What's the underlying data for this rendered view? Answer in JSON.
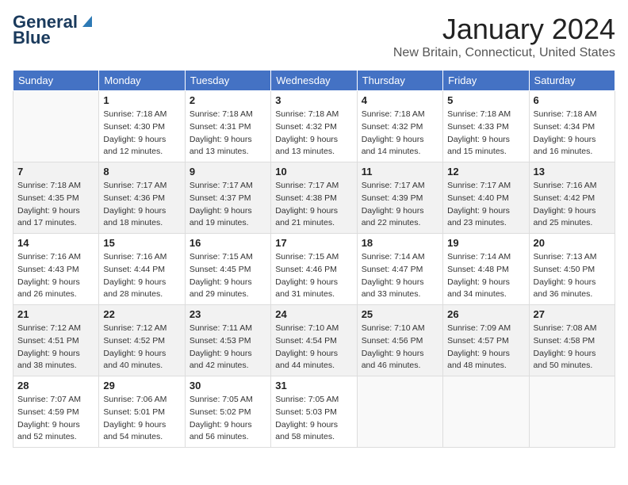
{
  "header": {
    "logo_line1": "General",
    "logo_line2": "Blue",
    "title": "January 2024",
    "subtitle": "New Britain, Connecticut, United States"
  },
  "days_of_week": [
    "Sunday",
    "Monday",
    "Tuesday",
    "Wednesday",
    "Thursday",
    "Friday",
    "Saturday"
  ],
  "weeks": [
    [
      {
        "num": "",
        "sunrise": "",
        "sunset": "",
        "daylight": ""
      },
      {
        "num": "1",
        "sunrise": "Sunrise: 7:18 AM",
        "sunset": "Sunset: 4:30 PM",
        "daylight": "Daylight: 9 hours and 12 minutes."
      },
      {
        "num": "2",
        "sunrise": "Sunrise: 7:18 AM",
        "sunset": "Sunset: 4:31 PM",
        "daylight": "Daylight: 9 hours and 13 minutes."
      },
      {
        "num": "3",
        "sunrise": "Sunrise: 7:18 AM",
        "sunset": "Sunset: 4:32 PM",
        "daylight": "Daylight: 9 hours and 13 minutes."
      },
      {
        "num": "4",
        "sunrise": "Sunrise: 7:18 AM",
        "sunset": "Sunset: 4:32 PM",
        "daylight": "Daylight: 9 hours and 14 minutes."
      },
      {
        "num": "5",
        "sunrise": "Sunrise: 7:18 AM",
        "sunset": "Sunset: 4:33 PM",
        "daylight": "Daylight: 9 hours and 15 minutes."
      },
      {
        "num": "6",
        "sunrise": "Sunrise: 7:18 AM",
        "sunset": "Sunset: 4:34 PM",
        "daylight": "Daylight: 9 hours and 16 minutes."
      }
    ],
    [
      {
        "num": "7",
        "sunrise": "Sunrise: 7:18 AM",
        "sunset": "Sunset: 4:35 PM",
        "daylight": "Daylight: 9 hours and 17 minutes."
      },
      {
        "num": "8",
        "sunrise": "Sunrise: 7:17 AM",
        "sunset": "Sunset: 4:36 PM",
        "daylight": "Daylight: 9 hours and 18 minutes."
      },
      {
        "num": "9",
        "sunrise": "Sunrise: 7:17 AM",
        "sunset": "Sunset: 4:37 PM",
        "daylight": "Daylight: 9 hours and 19 minutes."
      },
      {
        "num": "10",
        "sunrise": "Sunrise: 7:17 AM",
        "sunset": "Sunset: 4:38 PM",
        "daylight": "Daylight: 9 hours and 21 minutes."
      },
      {
        "num": "11",
        "sunrise": "Sunrise: 7:17 AM",
        "sunset": "Sunset: 4:39 PM",
        "daylight": "Daylight: 9 hours and 22 minutes."
      },
      {
        "num": "12",
        "sunrise": "Sunrise: 7:17 AM",
        "sunset": "Sunset: 4:40 PM",
        "daylight": "Daylight: 9 hours and 23 minutes."
      },
      {
        "num": "13",
        "sunrise": "Sunrise: 7:16 AM",
        "sunset": "Sunset: 4:42 PM",
        "daylight": "Daylight: 9 hours and 25 minutes."
      }
    ],
    [
      {
        "num": "14",
        "sunrise": "Sunrise: 7:16 AM",
        "sunset": "Sunset: 4:43 PM",
        "daylight": "Daylight: 9 hours and 26 minutes."
      },
      {
        "num": "15",
        "sunrise": "Sunrise: 7:16 AM",
        "sunset": "Sunset: 4:44 PM",
        "daylight": "Daylight: 9 hours and 28 minutes."
      },
      {
        "num": "16",
        "sunrise": "Sunrise: 7:15 AM",
        "sunset": "Sunset: 4:45 PM",
        "daylight": "Daylight: 9 hours and 29 minutes."
      },
      {
        "num": "17",
        "sunrise": "Sunrise: 7:15 AM",
        "sunset": "Sunset: 4:46 PM",
        "daylight": "Daylight: 9 hours and 31 minutes."
      },
      {
        "num": "18",
        "sunrise": "Sunrise: 7:14 AM",
        "sunset": "Sunset: 4:47 PM",
        "daylight": "Daylight: 9 hours and 33 minutes."
      },
      {
        "num": "19",
        "sunrise": "Sunrise: 7:14 AM",
        "sunset": "Sunset: 4:48 PM",
        "daylight": "Daylight: 9 hours and 34 minutes."
      },
      {
        "num": "20",
        "sunrise": "Sunrise: 7:13 AM",
        "sunset": "Sunset: 4:50 PM",
        "daylight": "Daylight: 9 hours and 36 minutes."
      }
    ],
    [
      {
        "num": "21",
        "sunrise": "Sunrise: 7:12 AM",
        "sunset": "Sunset: 4:51 PM",
        "daylight": "Daylight: 9 hours and 38 minutes."
      },
      {
        "num": "22",
        "sunrise": "Sunrise: 7:12 AM",
        "sunset": "Sunset: 4:52 PM",
        "daylight": "Daylight: 9 hours and 40 minutes."
      },
      {
        "num": "23",
        "sunrise": "Sunrise: 7:11 AM",
        "sunset": "Sunset: 4:53 PM",
        "daylight": "Daylight: 9 hours and 42 minutes."
      },
      {
        "num": "24",
        "sunrise": "Sunrise: 7:10 AM",
        "sunset": "Sunset: 4:54 PM",
        "daylight": "Daylight: 9 hours and 44 minutes."
      },
      {
        "num": "25",
        "sunrise": "Sunrise: 7:10 AM",
        "sunset": "Sunset: 4:56 PM",
        "daylight": "Daylight: 9 hours and 46 minutes."
      },
      {
        "num": "26",
        "sunrise": "Sunrise: 7:09 AM",
        "sunset": "Sunset: 4:57 PM",
        "daylight": "Daylight: 9 hours and 48 minutes."
      },
      {
        "num": "27",
        "sunrise": "Sunrise: 7:08 AM",
        "sunset": "Sunset: 4:58 PM",
        "daylight": "Daylight: 9 hours and 50 minutes."
      }
    ],
    [
      {
        "num": "28",
        "sunrise": "Sunrise: 7:07 AM",
        "sunset": "Sunset: 4:59 PM",
        "daylight": "Daylight: 9 hours and 52 minutes."
      },
      {
        "num": "29",
        "sunrise": "Sunrise: 7:06 AM",
        "sunset": "Sunset: 5:01 PM",
        "daylight": "Daylight: 9 hours and 54 minutes."
      },
      {
        "num": "30",
        "sunrise": "Sunrise: 7:05 AM",
        "sunset": "Sunset: 5:02 PM",
        "daylight": "Daylight: 9 hours and 56 minutes."
      },
      {
        "num": "31",
        "sunrise": "Sunrise: 7:05 AM",
        "sunset": "Sunset: 5:03 PM",
        "daylight": "Daylight: 9 hours and 58 minutes."
      },
      {
        "num": "",
        "sunrise": "",
        "sunset": "",
        "daylight": ""
      },
      {
        "num": "",
        "sunrise": "",
        "sunset": "",
        "daylight": ""
      },
      {
        "num": "",
        "sunrise": "",
        "sunset": "",
        "daylight": ""
      }
    ]
  ]
}
